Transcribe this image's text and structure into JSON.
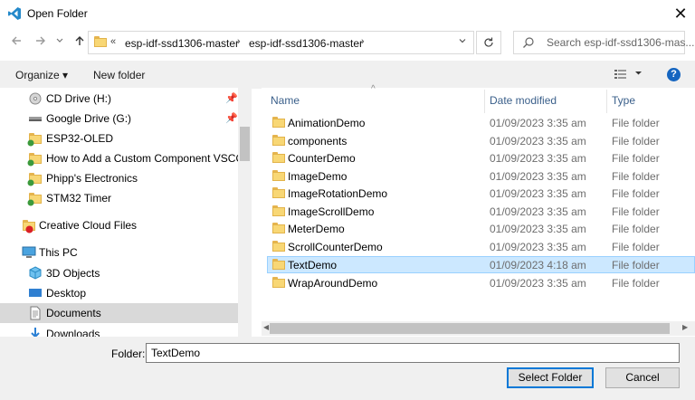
{
  "window": {
    "title": "Open Folder",
    "close_symbol": "✕"
  },
  "nav": {
    "back_icon": "back-arrow-icon",
    "forward_icon": "forward-arrow-icon",
    "recent_icon": "chevron-down-icon",
    "up_icon": "up-arrow-icon"
  },
  "address": {
    "prefix": "«",
    "crumbs": [
      "esp-idf-ssd1306-master",
      "esp-idf-ssd1306-master"
    ],
    "separator": "›"
  },
  "search": {
    "placeholder": "Search esp-idf-ssd1306-mas..."
  },
  "toolbar": {
    "organize_label": "Organize ▾",
    "new_folder_label": "New folder",
    "help_label": "?"
  },
  "sidebar": {
    "items": [
      {
        "label": "CD Drive (H:)",
        "icon": "cd-drive-icon",
        "pinned": true
      },
      {
        "label": "Google Drive (G:)",
        "icon": "drive-icon",
        "pinned": true
      },
      {
        "label": "ESP32-OLED",
        "icon": "folder-icon",
        "pinned": false
      },
      {
        "label": "How to Add a Custom Component VSCOD",
        "icon": "folder-icon",
        "pinned": false
      },
      {
        "label": "Phipp's Electronics",
        "icon": "folder-icon",
        "pinned": false
      },
      {
        "label": "STM32 Timer",
        "icon": "folder-icon",
        "pinned": false
      },
      {
        "label": "Creative Cloud Files",
        "icon": "creative-cloud-icon",
        "pinned": false
      },
      {
        "label": "This PC",
        "icon": "computer-icon",
        "pinned": false
      },
      {
        "label": "3D Objects",
        "icon": "3d-objects-icon",
        "pinned": false
      },
      {
        "label": "Desktop",
        "icon": "desktop-icon",
        "pinned": false
      },
      {
        "label": "Documents",
        "icon": "documents-icon",
        "pinned": false,
        "selected": true
      },
      {
        "label": "Downloads",
        "icon": "downloads-icon",
        "pinned": false
      }
    ]
  },
  "table": {
    "columns": [
      "Name",
      "Date modified",
      "Type"
    ],
    "rows": [
      {
        "name": "AnimationDemo",
        "date": "01/09/2023 3:35 am",
        "type": "File folder"
      },
      {
        "name": "components",
        "date": "01/09/2023 3:35 am",
        "type": "File folder"
      },
      {
        "name": "CounterDemo",
        "date": "01/09/2023 3:35 am",
        "type": "File folder"
      },
      {
        "name": "ImageDemo",
        "date": "01/09/2023 3:35 am",
        "type": "File folder"
      },
      {
        "name": "ImageRotationDemo",
        "date": "01/09/2023 3:35 am",
        "type": "File folder"
      },
      {
        "name": "ImageScrollDemo",
        "date": "01/09/2023 3:35 am",
        "type": "File folder"
      },
      {
        "name": "MeterDemo",
        "date": "01/09/2023 3:35 am",
        "type": "File folder"
      },
      {
        "name": "ScrollCounterDemo",
        "date": "01/09/2023 3:35 am",
        "type": "File folder"
      },
      {
        "name": "TextDemo",
        "date": "01/09/2023 4:18 am",
        "type": "File folder",
        "selected": true
      },
      {
        "name": "WrapAroundDemo",
        "date": "01/09/2023 3:35 am",
        "type": "File folder"
      }
    ]
  },
  "footer": {
    "folder_label": "Folder:",
    "folder_value": "TextDemo",
    "select_label": "Select Folder",
    "cancel_label": "Cancel"
  },
  "colors": {
    "accent": "#0078d7",
    "selection": "#cce8ff",
    "folder": "#f8d775"
  }
}
